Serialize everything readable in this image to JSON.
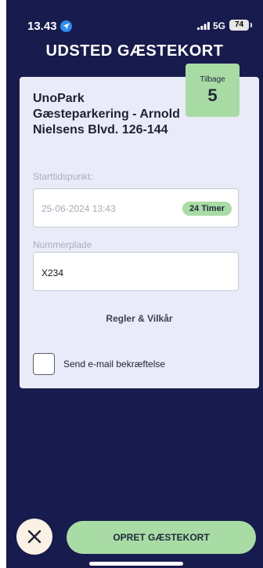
{
  "status_bar": {
    "time": "13.43",
    "network": "5G",
    "battery": "74"
  },
  "header": {
    "title": "UDSTED GÆSTEKORT"
  },
  "card": {
    "remaining_label": "Tilbage",
    "remaining_count": "5",
    "location_name": "UnoPark Gæsteparkering - Arnold Nielsens Blvd. 126-144",
    "start_label": "Starttidspunkt:",
    "start_value": "25-06-2024 13:43",
    "duration": "24 Timer",
    "plate_label": "Nummerplade",
    "plate_value": "X234",
    "terms_label": "Regler & Vilkår",
    "email_confirmation_label": "Send e-mail bekræftelse"
  },
  "actions": {
    "create_label": "OPRET GÆSTEKORT"
  },
  "colors": {
    "background": "#171b4d",
    "card": "#e9ecf8",
    "accent_green": "#a9dca4",
    "close_button": "#fbf1e4"
  }
}
